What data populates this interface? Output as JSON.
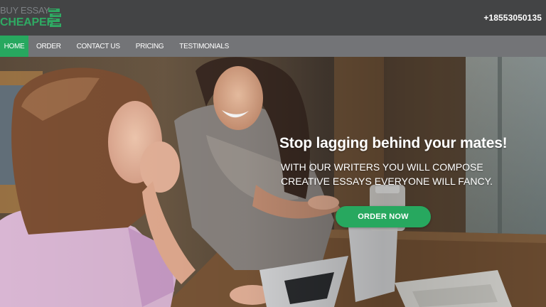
{
  "header": {
    "logo": {
      "line1": "BUY ESSAY",
      "line2": "CHEAPER",
      "icon": "book-stack-icon"
    },
    "phone": "+18553050135"
  },
  "nav": {
    "items": [
      {
        "label": "HOME",
        "active": true
      },
      {
        "label": "ORDER",
        "active": false
      },
      {
        "label": "CONTACT US",
        "active": false
      },
      {
        "label": "PRICING",
        "active": false
      },
      {
        "label": "TESTIMONIALS",
        "active": false
      }
    ]
  },
  "hero": {
    "title": "Stop lagging behind your mates!",
    "subtitle": "WITH OUR WRITERS YOU WILL COMPOSE CREATIVE ESSAYS EVERYONE WILL FANCY.",
    "cta_label": "ORDER NOW"
  },
  "colors": {
    "header_bg": "#434445",
    "nav_bg": "#737477",
    "accent": "#27a85f",
    "text_light": "#ffffff"
  }
}
